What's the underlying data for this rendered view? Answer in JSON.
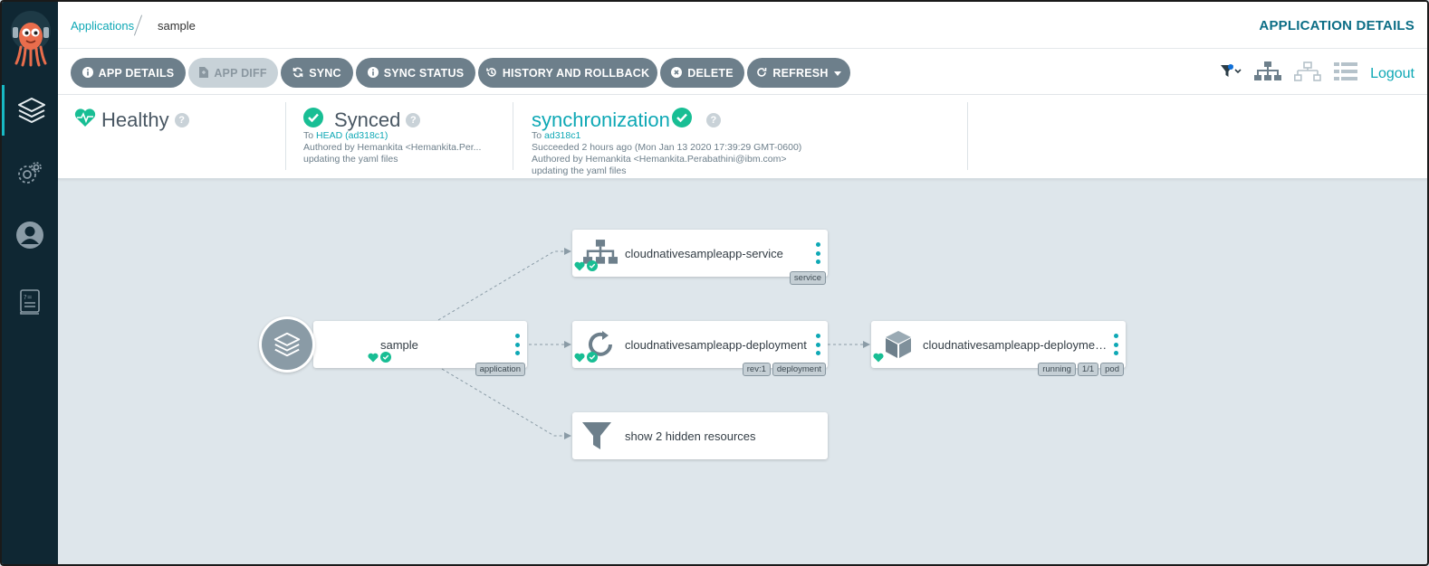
{
  "nav": {
    "breadcrumb_root": "Applications",
    "breadcrumb_current": "sample",
    "page_heading": "APPLICATION DETAILS"
  },
  "sidebar": {
    "items": [
      {
        "name": "applications",
        "icon": "layers-icon",
        "active": true
      },
      {
        "name": "settings",
        "icon": "gear-icon",
        "active": false
      },
      {
        "name": "user-info",
        "icon": "user-icon",
        "active": false
      },
      {
        "name": "documentation",
        "icon": "docs-icon",
        "active": false
      }
    ]
  },
  "toolbar": {
    "buttons": [
      {
        "label": "APP DETAILS",
        "icon": "info-icon"
      },
      {
        "label": "APP DIFF",
        "icon": "file-diff-icon",
        "disabled": true
      },
      {
        "label": "SYNC",
        "icon": "sync-icon"
      },
      {
        "label": "SYNC STATUS",
        "icon": "info-icon"
      },
      {
        "label": "HISTORY AND ROLLBACK",
        "icon": "history-icon"
      },
      {
        "label": "DELETE",
        "icon": "times-circle-icon"
      },
      {
        "label": "REFRESH",
        "icon": "redo-icon"
      }
    ],
    "logout_label": "Logout"
  },
  "status": {
    "health": {
      "label": "Healthy"
    },
    "sync": {
      "label": "Synced",
      "to_prefix": "To",
      "target": "HEAD (ad318c1)",
      "author": "Authored by Hemankita <Hemankita.Per...",
      "message": "updating the yaml files"
    },
    "operation": {
      "label": "synchronization",
      "to_prefix": "To",
      "revision": "ad318c1",
      "result": "Succeeded 2 hours ago (Mon Jan 13 2020 17:39:29 GMT-0600)",
      "author": "Authored by Hemankita <Hemankita.Perabathini@ibm.com>",
      "message": "updating the yaml files"
    }
  },
  "graph": {
    "app_node": {
      "label": "sample",
      "badges": [
        "application"
      ]
    },
    "service_node": {
      "label": "cloudnativesampleapp-service",
      "badges": [
        "service"
      ]
    },
    "deployment_node": {
      "label": "cloudnativesampleapp-deployment",
      "badges": [
        "rev:1",
        "deployment"
      ]
    },
    "pod_node": {
      "label": "cloudnativesampleapp-deploymen...",
      "badges": [
        "running",
        "1/1",
        "pod"
      ]
    },
    "hidden_node": {
      "label": "show 2 hidden resources"
    }
  },
  "colors": {
    "accent": "#0ea8b5",
    "sidebar": "#0f2733",
    "healthy": "#18be94",
    "button": "#6d7f8b"
  }
}
